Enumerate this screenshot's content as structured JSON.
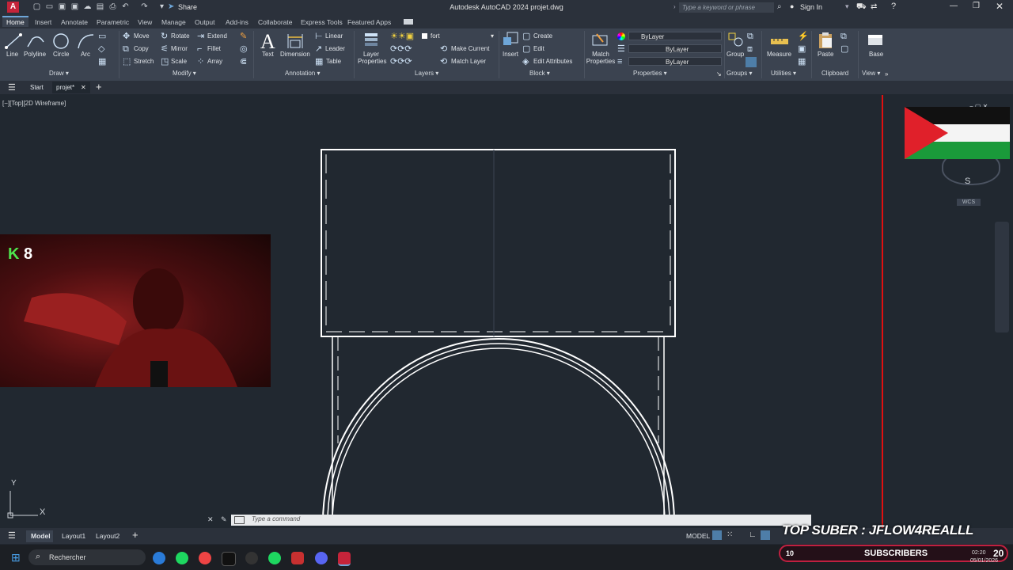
{
  "title_bar": {
    "app_logo": "A",
    "share_label": "Share",
    "title": "Autodesk AutoCAD 2024   projet.dwg",
    "search_placeholder": "Type a keyword or phrase",
    "sign_in": "Sign In"
  },
  "ribbon_tabs": [
    "Home",
    "Insert",
    "Annotate",
    "Parametric",
    "View",
    "Manage",
    "Output",
    "Add-ins",
    "Collaborate",
    "Express Tools",
    "Featured Apps"
  ],
  "draw": {
    "line": "Line",
    "polyline": "Polyline",
    "circle": "Circle",
    "arc": "Arc",
    "title": "Draw ▾"
  },
  "modify": {
    "move": "Move",
    "rotate": "Rotate",
    "extend": "Extend",
    "copy": "Copy",
    "mirror": "Mirror",
    "fillet": "Fillet",
    "stretch": "Stretch",
    "scale": "Scale",
    "array": "Array",
    "title": "Modify ▾"
  },
  "annotation": {
    "text": "Text",
    "dimension": "Dimension",
    "linear": "Linear",
    "leader": "Leader",
    "table": "Table",
    "title": "Annotation ▾"
  },
  "layers": {
    "layer_properties": "Layer Properties",
    "current_layer": "fort",
    "make_current": "Make Current",
    "match_layer": "Match Layer",
    "title": "Layers ▾"
  },
  "block": {
    "insert": "Insert",
    "create": "Create",
    "edit": "Edit",
    "edit_attributes": "Edit Attributes",
    "title": "Block ▾"
  },
  "properties": {
    "match_properties": "Match Properties",
    "color": "ByLayer",
    "linetype": "ByLayer",
    "lineweight": "ByLayer",
    "title": "Properties ▾"
  },
  "groups": {
    "group": "Group",
    "title": "Groups ▾"
  },
  "utilities": {
    "measure": "Measure",
    "title": "Utilities ▾"
  },
  "clipboard": {
    "paste": "Paste",
    "title": "Clipboard"
  },
  "view_panel": {
    "base": "Base",
    "title": "View ▾"
  },
  "file_tabs": {
    "start": "Start",
    "active": "projet*"
  },
  "viewport_label": "[−][Top][2D Wireframe]",
  "viewcube": {
    "face": "S",
    "wcs": "WCS"
  },
  "webcam": {
    "badge_letter": "K",
    "badge_count": "8"
  },
  "command_line": {
    "placeholder": "Type  a  command"
  },
  "ucs": {
    "y": "Y",
    "x": "X"
  },
  "layout_tabs": [
    "Model",
    "Layout1",
    "Layout2"
  ],
  "status": {
    "model": "MODEL"
  },
  "overlay": {
    "top_suber": "TOP SUBER : JFLOW4REALLL",
    "sub_count": "10",
    "subscribers": "SUBSCRIBERS",
    "sub_goal": "20"
  },
  "taskbar": {
    "search": "Rechercher",
    "time": "02:20",
    "date": "05/01/2026"
  },
  "colors": {
    "canvas": "#212830",
    "ribbon": "#3b4350",
    "accent_red": "#c5243a",
    "crosshair": "#e01010"
  }
}
